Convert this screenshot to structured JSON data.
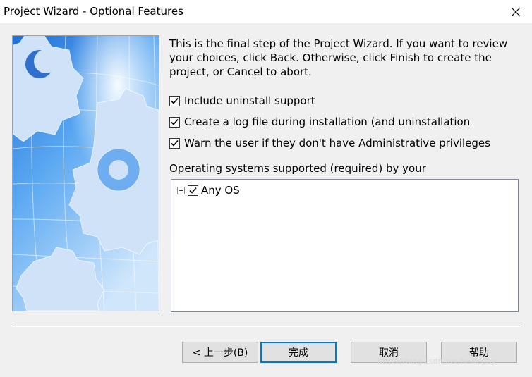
{
  "window": {
    "title": "Project Wizard - Optional Features"
  },
  "intro": {
    "text": "This is the final step of the Project Wizard. If you want to review your choices, click Back. Otherwise, click Finish to create the project, or Cancel to abort."
  },
  "options": [
    {
      "label": "Include uninstall support",
      "checked": true
    },
    {
      "label": "Create a log file during installation (and uninstallation",
      "checked": true
    },
    {
      "label": "Warn the user if they don't have Administrative privileges",
      "checked": true
    }
  ],
  "os": {
    "label": "Operating systems supported (required) by your",
    "tree": [
      {
        "label": "Any OS",
        "checked": true,
        "expandable": true
      }
    ]
  },
  "buttons": {
    "back": "< 上一步(B)",
    "finish": "完成",
    "cancel": "取消",
    "help": "帮助"
  },
  "watermark": "https://blog.csdn.net/heikeguy",
  "icons": {
    "close": "close-icon",
    "check": "check-icon",
    "expand": "plus-box-icon"
  },
  "colors": {
    "accent": "#0078d7",
    "art_sky": "#3a8fe8"
  }
}
